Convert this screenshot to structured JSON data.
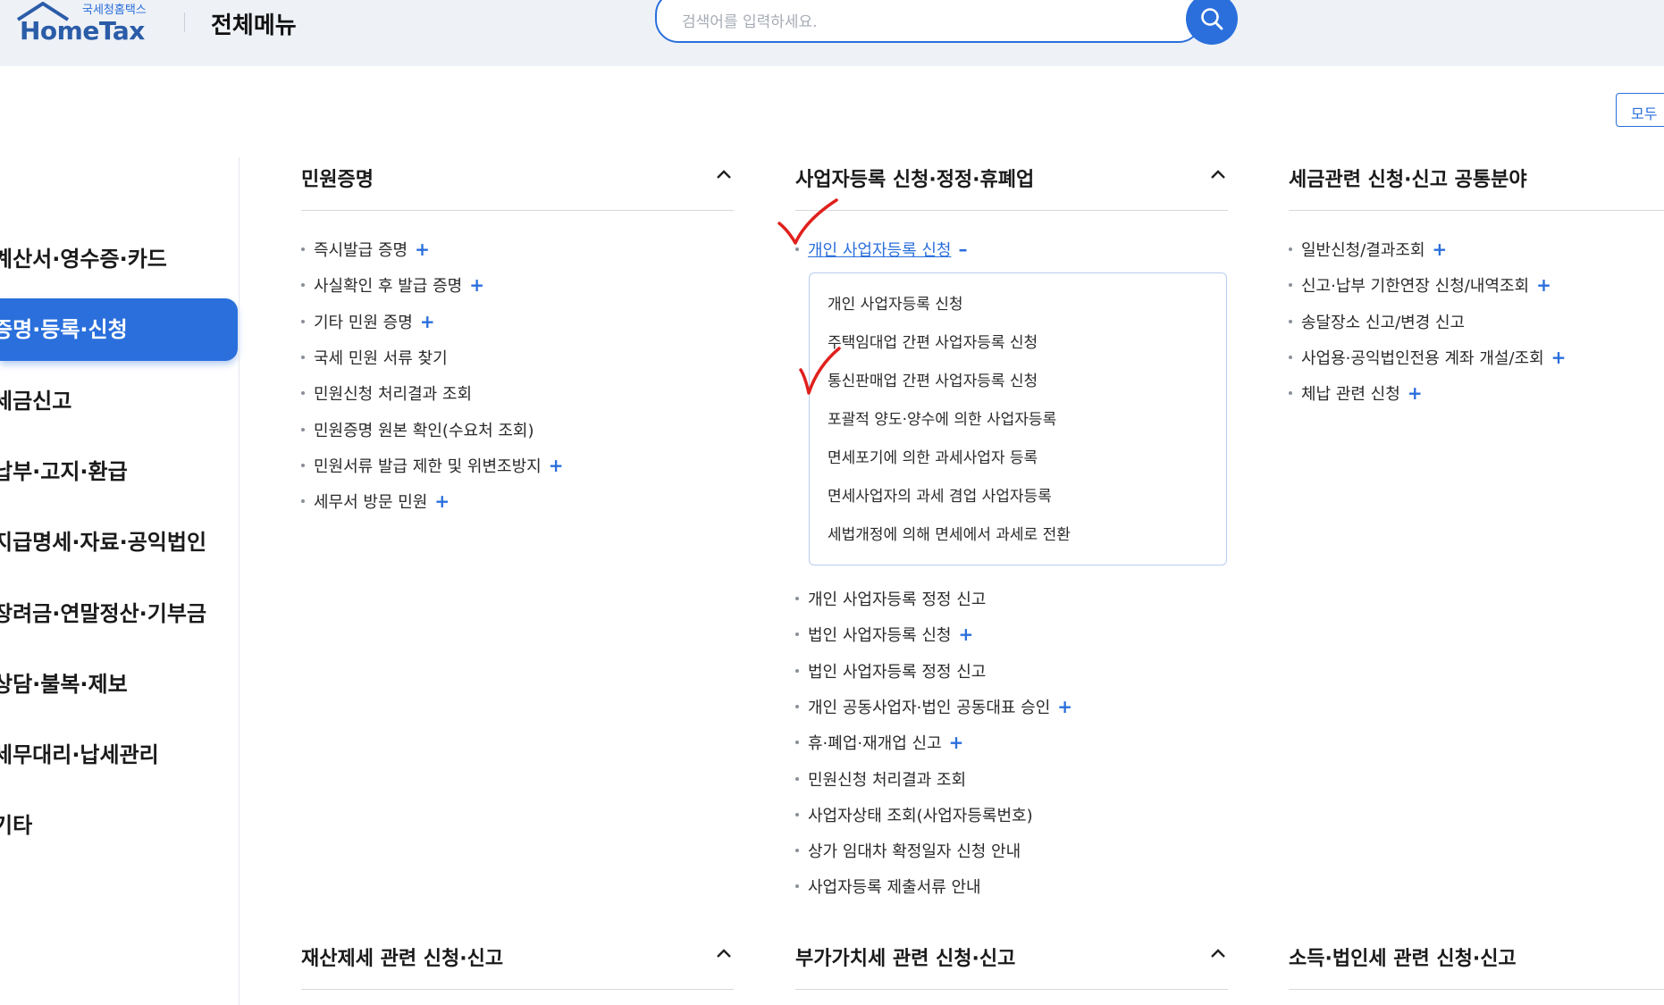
{
  "header": {
    "logo_small": "국세청홈택스",
    "logo_big": "HomeTax",
    "title": "전체메뉴",
    "search_placeholder": "검색어를 입력하세요.",
    "expand_all": "모두"
  },
  "sidebar": {
    "items": [
      {
        "label": "계산서·영수증·카드",
        "active": false
      },
      {
        "label": "증명·등록·신청",
        "active": true
      },
      {
        "label": "세금신고",
        "active": false
      },
      {
        "label": "납부·고지·환급",
        "active": false
      },
      {
        "label": "지급명세·자료·공익법인",
        "active": false
      },
      {
        "label": "장려금·연말정산·기부금",
        "active": false
      },
      {
        "label": "상담·불복·제보",
        "active": false
      },
      {
        "label": "세무대리·납세관리",
        "active": false
      },
      {
        "label": "기타",
        "active": false
      }
    ]
  },
  "sections": {
    "minwon": {
      "title": "민원증명",
      "items": [
        {
          "label": "즉시발급 증명",
          "plus": true
        },
        {
          "label": "사실확인 후 발급 증명",
          "plus": true
        },
        {
          "label": "기타 민원 증명",
          "plus": true
        },
        {
          "label": "국세 민원 서류 찾기",
          "plus": false
        },
        {
          "label": "민원신청 처리결과 조회",
          "plus": false
        },
        {
          "label": "민원증명 원본 확인(수요처 조회)",
          "plus": false
        },
        {
          "label": "민원서류 발급 제한 및 위변조방지",
          "plus": true
        },
        {
          "label": "세무서 방문 민원",
          "plus": true
        }
      ]
    },
    "business": {
      "title": "사업자등록 신청·정정·휴폐업",
      "expanded_item": "개인 사업자등록 신청",
      "submenu": [
        "개인 사업자등록 신청",
        "주택임대업 간편 사업자등록 신청",
        "통신판매업 간편 사업자등록 신청",
        "포괄적 양도·양수에 의한 사업자등록",
        "면세포기에 의한 과세사업자 등록",
        "면세사업자의 과세 겸업 사업자등록",
        "세법개정에 의해 면세에서 과세로 전환"
      ],
      "items": [
        {
          "label": "개인 사업자등록 정정 신고",
          "plus": false
        },
        {
          "label": "법인 사업자등록 신청",
          "plus": true
        },
        {
          "label": "법인 사업자등록 정정 신고",
          "plus": false
        },
        {
          "label": "개인 공동사업자·법인 공동대표 승인",
          "plus": true
        },
        {
          "label": "휴·폐업·재개업 신고",
          "plus": true
        },
        {
          "label": "민원신청 처리결과 조회",
          "plus": false
        },
        {
          "label": "사업자상태 조회(사업자등록번호)",
          "plus": false
        },
        {
          "label": "상가 임대차 확정일자 신청 안내",
          "plus": false
        },
        {
          "label": "사업자등록 제출서류 안내",
          "plus": false
        }
      ]
    },
    "common": {
      "title": "세금관련 신청·신고 공통분야",
      "items": [
        {
          "label": "일반신청/결과조회",
          "plus": true
        },
        {
          "label": "신고·납부 기한연장 신청/내역조회",
          "plus": true
        },
        {
          "label": "송달장소 신고/변경 신고",
          "plus": false
        },
        {
          "label": "사업용·공익법인전용 계좌 개설/조회",
          "plus": true
        },
        {
          "label": "체납 관련 신청",
          "plus": true
        }
      ]
    },
    "property": {
      "title": "재산제세 관련 신청·신고"
    },
    "vat": {
      "title": "부가가치세 관련 신청·신고"
    },
    "income": {
      "title": "소득·법인세 관련 신청·신고"
    }
  },
  "colors": {
    "accent": "#2a6fdc",
    "check_mark": "#e0201c",
    "header_bg": "#eef1f6"
  },
  "icons": {
    "plus": "+",
    "minus": "–"
  }
}
